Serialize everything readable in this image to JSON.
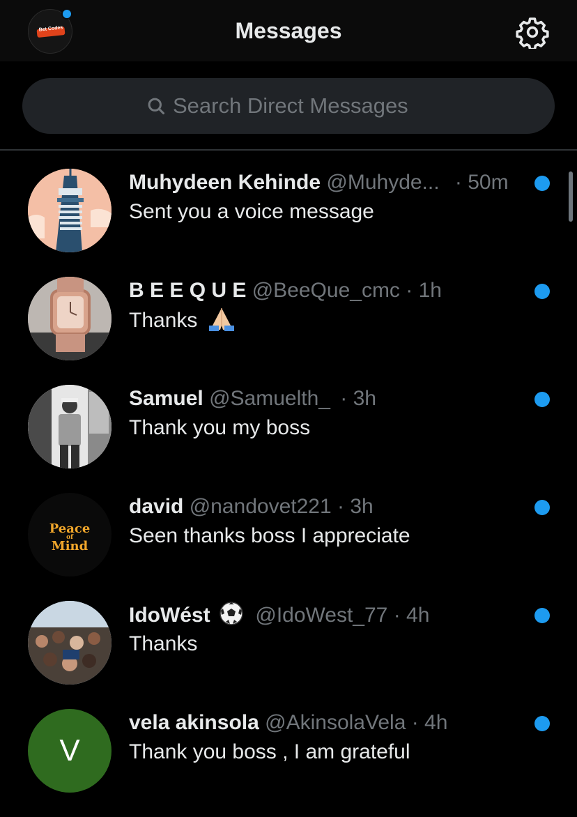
{
  "header": {
    "title": "Messages",
    "avatar_logo_text": "Bet Codes",
    "settings_icon": "gear-icon",
    "notification_dot_color": "#1d9bf0"
  },
  "search": {
    "placeholder": "Search Direct Messages",
    "icon": "search-icon"
  },
  "colors": {
    "background": "#000000",
    "primary_text": "#e7e9ea",
    "secondary_text": "#71767b",
    "accent": "#1d9bf0",
    "search_bg": "#202327"
  },
  "conversations": [
    {
      "name": "Muhydeen Kehinde",
      "handle": "@Muhyde...",
      "time": "· 50m",
      "preview": "Sent you a voice message",
      "unread": true
    },
    {
      "name": "B E E Q U E",
      "handle": "@BeeQue_cmc",
      "time": "· 1h",
      "preview": "Thanks",
      "preview_emoji": "folded-hands-emoji",
      "unread": true
    },
    {
      "name": "Samuel",
      "handle": "@Samuelth_",
      "time": "· 3h",
      "preview": "Thank you my boss",
      "unread": true
    },
    {
      "name": "david",
      "handle": "@nandovet221",
      "time": "· 3h",
      "preview": "Seen thanks boss I appreciate",
      "unread": true,
      "avatar_text": [
        "Peace",
        "of",
        "Mind"
      ]
    },
    {
      "name": "IdoWést",
      "name_emoji": "soccer-ball-emoji",
      "handle": "@IdoWest_77",
      "time": "· 4h",
      "preview": "Thanks",
      "unread": true
    },
    {
      "name": "vela akinsola",
      "handle": "@AkinsolaVela",
      "time": "· 4h",
      "preview": "Thank you boss , I am grateful",
      "unread": true,
      "avatar_letter": "V"
    }
  ]
}
